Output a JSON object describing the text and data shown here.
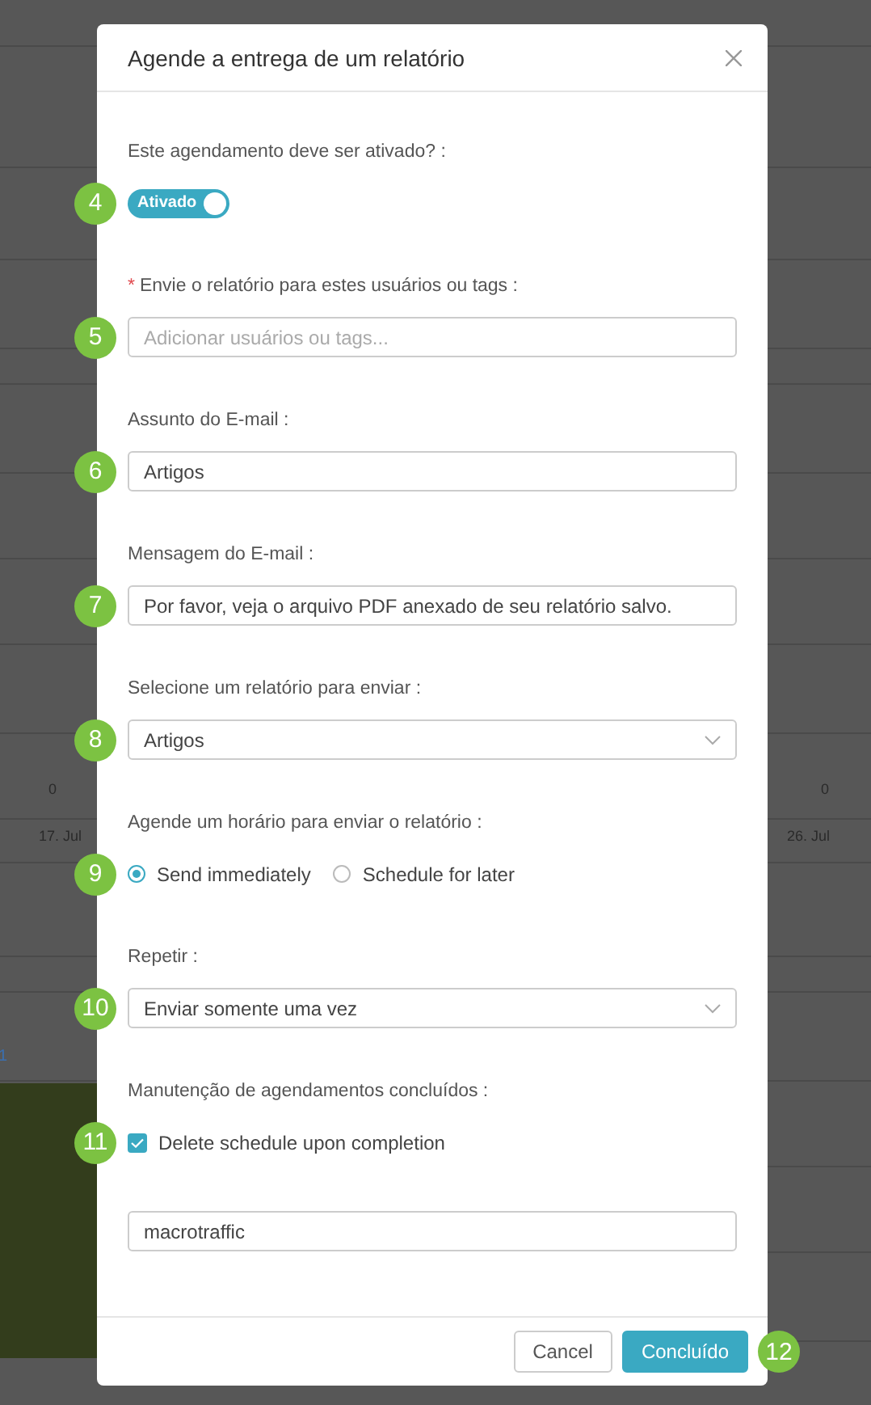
{
  "background": {
    "values": [
      {
        "text": "0"
      },
      {
        "text": "0"
      }
    ],
    "dates": [
      {
        "text": "17. Jul"
      },
      {
        "text": "26. Jul"
      }
    ],
    "series_mark": "1"
  },
  "dialog": {
    "title": "Agende a entrega de um relatório",
    "fields": [
      {
        "kind": "toggle",
        "label": "Este agendamento deve ser ativado? :",
        "step": "4",
        "on": true,
        "text": "Ativado"
      },
      {
        "kind": "tags",
        "required_mark": "*",
        "label": "Envie o relatório para estes usuários ou tags :",
        "step": "5",
        "placeholder": "Adicionar usuários ou tags..."
      },
      {
        "kind": "text",
        "label": "Assunto do E-mail :",
        "step": "6",
        "value": "Artigos"
      },
      {
        "kind": "text",
        "label": "Mensagem do E-mail :",
        "step": "7",
        "value": "Por favor, veja o arquivo PDF anexado de seu relatório salvo."
      },
      {
        "kind": "select",
        "label": "Selecione um relatório para enviar :",
        "step": "8",
        "value": "Artigos"
      },
      {
        "kind": "radio",
        "label": "Agende um horário para enviar o relatório :",
        "step": "9",
        "options": [
          {
            "label": "Send immediately",
            "selected": true
          },
          {
            "label": "Schedule for later",
            "selected": false
          }
        ]
      },
      {
        "kind": "select",
        "label": "Repetir :",
        "step": "10",
        "value": "Enviar somente uma vez"
      },
      {
        "kind": "checkbox",
        "label": "Manutenção de agendamentos concluídos :",
        "step": "11",
        "checked": true,
        "text": "Delete schedule upon completion"
      },
      {
        "kind": "text",
        "value": "macrotraffic"
      }
    ],
    "buttons": [
      {
        "label": "Cancel",
        "kind": "secondary"
      },
      {
        "label": "Concluído",
        "kind": "primary",
        "step": "12"
      }
    ]
  }
}
